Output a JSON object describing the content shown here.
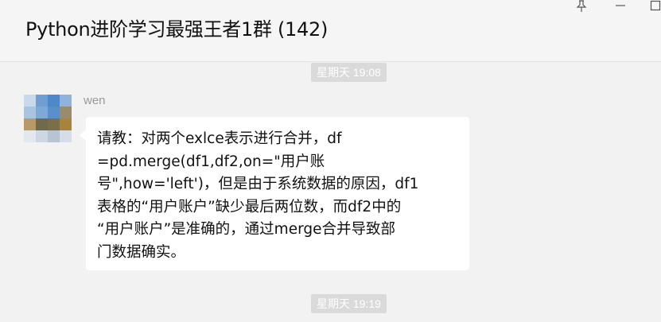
{
  "header": {
    "title": "Python进阶学习最强王者1群 (142)",
    "pin_icon": "pin-icon",
    "minimize_icon": "minimize-icon",
    "maximize_icon": "maximize-icon"
  },
  "messages": {
    "timestamp1": "星期天 19:08",
    "sender": "wen",
    "text_lines": [
      "请教：对两个exlce表示进行合并，df",
      "=pd.merge(df1,df2,on=\"用户账",
      "号\",how='left')，但是由于系统数据的原因，df1",
      "表格的“用户账户”缺少最后两位数，而df2中的",
      "“用户账户”是准确的，通过merge合并导致部",
      "门数据确实。"
    ],
    "timestamp2": "星期天 19:19"
  },
  "colors": {
    "background": "#f2f2f2",
    "bubble": "#ffffff",
    "timestamp_bg": "#dadada",
    "timestamp_text": "#ffffff"
  },
  "avatar": {
    "icon": "pixelated-avatar-icon",
    "pixels": [
      "#c9d9ea",
      "#6f9fd2",
      "#4f88c8",
      "#8fb3dc",
      "#a9c4e0",
      "#7da9d6",
      "#5a8fc9",
      "#9a8b6a",
      "#b89a66",
      "#6f6a4c",
      "#7b6f48",
      "#a8833c",
      "#e3e8ef",
      "#cdd6e2",
      "#b6c4d4",
      "#d6dde6"
    ]
  }
}
